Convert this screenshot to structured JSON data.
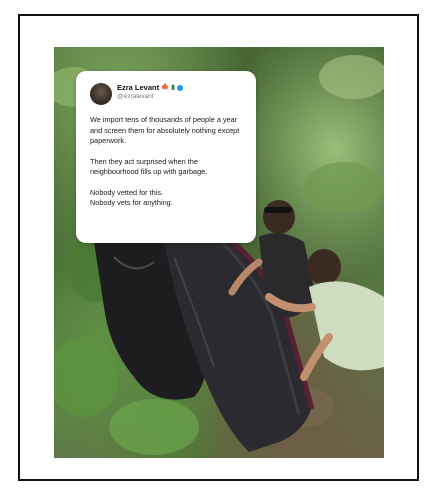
{
  "tweet": {
    "display_name": "Ezra Levant",
    "handle": "@ezralevant",
    "emoji_leaf": "🍁",
    "emoji_flag": "▮",
    "paragraphs": [
      "We import tens of thousands of people a year and screen them for absolutely nothing except paperwork.",
      "Then they act surprised when the neighbourhood fills up with garbage.",
      "Nobody vetted for this.\nNobody vets for anything."
    ]
  },
  "colors": {
    "verified": "#1d9bf0",
    "frame_border": "#111111"
  },
  "icons": {
    "avatar": "profile-avatar",
    "verified": "verified-badge-icon",
    "leaf": "maple-leaf-emoji-icon",
    "flag": "flag-emoji-icon"
  }
}
